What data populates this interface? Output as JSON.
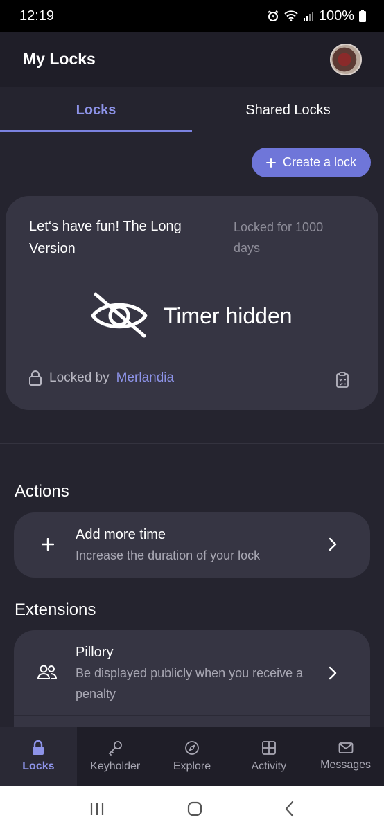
{
  "status_bar": {
    "time": "12:19",
    "battery": "100%"
  },
  "app_bar": {
    "title": "My Locks"
  },
  "tabs": [
    {
      "label": "Locks",
      "active": true
    },
    {
      "label": "Shared Locks",
      "active": false
    }
  ],
  "create_button": {
    "label": "Create a lock",
    "icon": "plus-icon"
  },
  "lock_card": {
    "name": "Let‘s have fun! The Long Version",
    "duration": "Locked for 1000 days",
    "timer_status": "Timer hidden",
    "locked_by_prefix": "Locked by",
    "keyholder": "Merlandia"
  },
  "actions": {
    "title": "Actions",
    "items": [
      {
        "title": "Add more time",
        "description": "Increase the duration of your lock",
        "icon": "plus-icon"
      }
    ]
  },
  "extensions": {
    "title": "Extensions",
    "items": [
      {
        "title": "Pillory",
        "description": "Be displayed publicly when you receive a penalty",
        "icon": "users-icon"
      }
    ]
  },
  "bottom_nav": [
    {
      "label": "Locks",
      "icon": "lock-icon",
      "active": true
    },
    {
      "label": "Keyholder",
      "icon": "key-icon",
      "active": false
    },
    {
      "label": "Explore",
      "icon": "compass-icon",
      "active": false
    },
    {
      "label": "Activity",
      "icon": "grid-icon",
      "active": false
    },
    {
      "label": "Messages",
      "icon": "envelope-icon",
      "active": false
    }
  ],
  "colors": {
    "accent": "#8d93e8",
    "button": "#6f76d9",
    "background": "#25242f",
    "card": "#363543"
  }
}
